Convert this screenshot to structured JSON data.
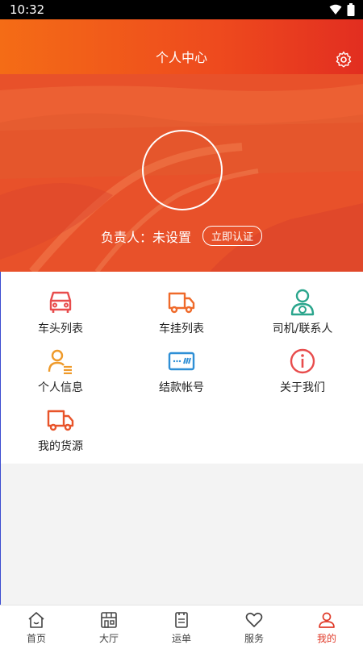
{
  "status_bar": {
    "time": "10:32"
  },
  "header": {
    "title": "个人中心"
  },
  "profile": {
    "owner_label": "负责人：未设置",
    "verify_button": "立即认证"
  },
  "menu": {
    "items": [
      {
        "label": "车头列表",
        "icon": "truck-front-icon"
      },
      {
        "label": "车挂列表",
        "icon": "truck-icon"
      },
      {
        "label": "司机/联系人",
        "icon": "driver-icon"
      },
      {
        "label": "个人信息",
        "icon": "person-info-icon"
      },
      {
        "label": "结款帐号",
        "icon": "card-icon"
      },
      {
        "label": "关于我们",
        "icon": "info-icon"
      },
      {
        "label": "我的货源",
        "icon": "cargo-truck-icon"
      }
    ]
  },
  "tabbar": {
    "tabs": [
      {
        "label": "首页",
        "icon": "home-icon"
      },
      {
        "label": "大厅",
        "icon": "hall-icon"
      },
      {
        "label": "运单",
        "icon": "waybill-icon"
      },
      {
        "label": "服务",
        "icon": "heart-icon"
      },
      {
        "label": "我的",
        "icon": "user-icon",
        "active": true
      }
    ]
  },
  "colors": {
    "accent": "#e03b2a",
    "menu_red": "#e84c4c",
    "menu_orange": "#ef7a2a",
    "menu_green": "#2aa58c",
    "menu_blue": "#2e8fd6"
  }
}
